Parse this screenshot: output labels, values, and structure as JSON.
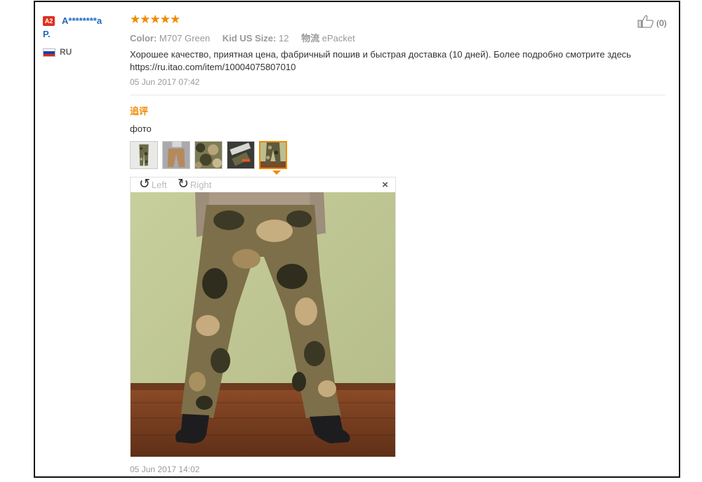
{
  "user": {
    "badge": "A2",
    "name_line1": "A********a",
    "name_line2": "P.",
    "country": "RU"
  },
  "review": {
    "stars": "★★★★★",
    "rating": 5,
    "attrs": [
      {
        "label": "Color:",
        "value": "M707 Green"
      },
      {
        "label": "Kid US Size:",
        "value": "12"
      },
      {
        "label": "物流",
        "value": "ePacket"
      }
    ],
    "text_line1": "Хорошее качество, приятная цена, фабричный пошив и быстрая доставка (10 дней). Более подробно смотрите здесь",
    "text_line2": "https://ru.itao.com/item/10004075807010",
    "date": "05 Jun 2017 07:42",
    "helpful_count": "(0)"
  },
  "followup": {
    "title": "追评",
    "text": "фото",
    "thumbnails": [
      "pants-front",
      "pants-back",
      "fabric-closeup",
      "pants-folded",
      "pants-worn"
    ],
    "active_thumbnail": 4,
    "viewer": {
      "rotate_left": "Left",
      "rotate_right": "Right",
      "close": "×"
    },
    "date": "05 Jun 2017 14:02"
  },
  "colors": {
    "accent": "#f08a00",
    "link": "#2168c2",
    "badge": "#e0301e"
  }
}
